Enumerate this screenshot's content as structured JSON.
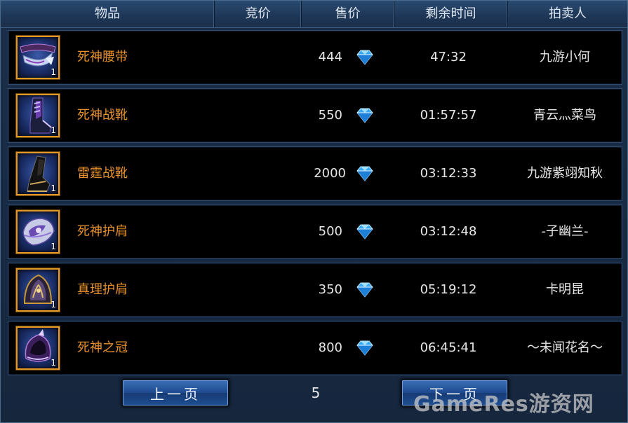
{
  "header": {
    "columns": [
      "物品",
      "竞价",
      "售价",
      "剩余时间",
      "拍卖人"
    ]
  },
  "rows": [
    {
      "name": "死神腰带",
      "stack": "1",
      "price": "444",
      "time": "47:32",
      "seller": "九游小何",
      "icon": "belt-icon"
    },
    {
      "name": "死神战靴",
      "stack": "1",
      "price": "550",
      "time": "01:57:57",
      "seller": "青云灬菜鸟",
      "icon": "boots-icon"
    },
    {
      "name": "雷霆战靴",
      "stack": "1",
      "price": "2000",
      "time": "03:12:33",
      "seller": "九游紫翊知秋",
      "icon": "boots-icon"
    },
    {
      "name": "死神护肩",
      "stack": "1",
      "price": "500",
      "time": "03:12:48",
      "seller": "-子幽兰-",
      "icon": "shoulder-icon"
    },
    {
      "name": "真理护肩",
      "stack": "1",
      "price": "350",
      "time": "05:19:12",
      "seller": "卡明昆",
      "icon": "shoulder-icon"
    },
    {
      "name": "死神之冠",
      "stack": "1",
      "price": "800",
      "time": "06:45:41",
      "seller": "～未闻花名～",
      "icon": "helmet-icon"
    }
  ],
  "pager": {
    "prev_label": "上一页",
    "next_label": "下一页",
    "page": "5"
  },
  "watermark": "GameRes游资网",
  "colors": {
    "item_name": "#e8912a",
    "icon_border": "#e39a24",
    "gem": "#4fc3ff",
    "button": "#1e4a8e"
  }
}
